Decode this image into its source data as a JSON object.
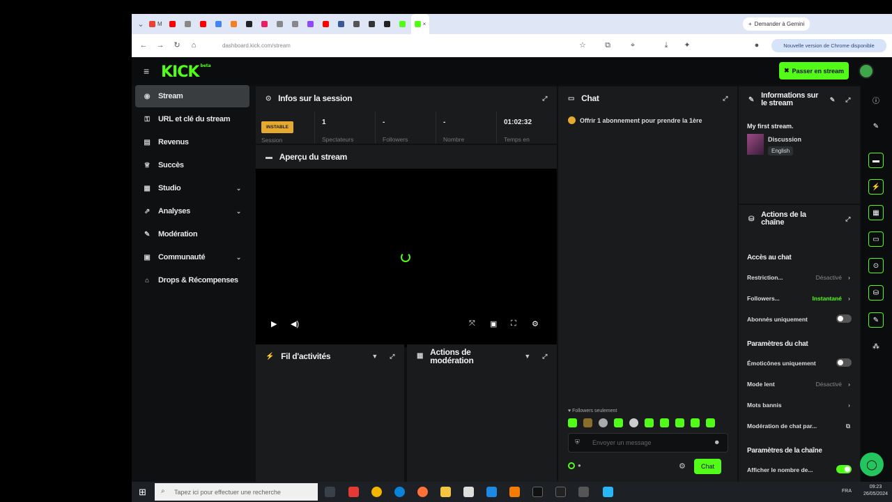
{
  "browser": {
    "tabs": [
      {
        "label": "M",
        "color": "#ea4335"
      },
      {
        "label": "",
        "color": "#ff0000"
      },
      {
        "label": "",
        "color": "#888"
      },
      {
        "label": "",
        "color": "#ff0000"
      },
      {
        "label": "",
        "color": "#4285f4"
      },
      {
        "label": "",
        "color": "#f48024"
      },
      {
        "label": "",
        "color": "#222"
      },
      {
        "label": "",
        "color": "#e91e63"
      },
      {
        "label": "",
        "color": "#888"
      },
      {
        "label": "",
        "color": "#888"
      },
      {
        "label": "",
        "color": "#9146ff"
      },
      {
        "label": "",
        "color": "#ff0000"
      },
      {
        "label": "",
        "color": "#3b5998"
      },
      {
        "label": "",
        "color": "#555"
      },
      {
        "label": "",
        "color": "#333"
      },
      {
        "label": "",
        "color": "#222"
      },
      {
        "label": "",
        "color": "#53fc18"
      }
    ],
    "ask_gemini": "Demander à Gemini",
    "url": "dashboard.kick.com/stream",
    "new_version": "Nouvelle version de Chrome disponible"
  },
  "topbar": {
    "logo": "KICK",
    "logo_sup": "beta",
    "go_live": "Passer en stream"
  },
  "sidebar": {
    "items": [
      {
        "label": "Stream",
        "icon": "stream-icon"
      },
      {
        "label": "URL et clé du stream",
        "icon": "key-icon"
      },
      {
        "label": "Revenus",
        "icon": "revenue-icon"
      },
      {
        "label": "Succès",
        "icon": "trophy-icon"
      },
      {
        "label": "Studio",
        "icon": "studio-icon"
      },
      {
        "label": "Analyses",
        "icon": "analytics-icon"
      },
      {
        "label": "Modération",
        "icon": "wrench-icon"
      },
      {
        "label": "Communauté",
        "icon": "community-icon"
      },
      {
        "label": "Drops & Récompenses",
        "icon": "gift-icon"
      }
    ]
  },
  "session": {
    "title": "Infos sur la session",
    "badge": "INSTABLE",
    "badge_label": "Session",
    "stats": [
      {
        "value": "1",
        "label": "Spectateurs"
      },
      {
        "value": "-",
        "label": "Followers"
      },
      {
        "value": "-",
        "label": "Nombre"
      },
      {
        "value": "01:02:32",
        "label": "Temps en"
      }
    ]
  },
  "preview": {
    "title": "Aperçu du stream"
  },
  "activity": {
    "title": "Fil d'activités"
  },
  "modactions": {
    "title": "Actions de modération"
  },
  "chat": {
    "title": "Chat",
    "gift_msg": "Offrir 1 abonnement pour prendre la 1ère",
    "followers_only": "Followers seulement",
    "placeholder": "Envoyer un message",
    "send": "Chat"
  },
  "info": {
    "title": "Informations sur le stream",
    "stream_title": "My first stream.",
    "category": "Discussion",
    "language": "English"
  },
  "chanactions": {
    "title": "Actions de la chaîne",
    "section_chat_access": "Accès au chat",
    "restriction": "Restriction...",
    "restriction_val": "Désactivé",
    "followers": "Followers...",
    "followers_val": "Instantané",
    "subs_only": "Abonnés uniquement",
    "section_chat_params": "Paramètres du chat",
    "emotes_only": "Émoticônes uniquement",
    "slow_mode": "Mode lent",
    "slow_mode_val": "Désactivé",
    "banned_words": "Mots bannis",
    "chat_moderation": "Modération de chat par...",
    "section_channel_params": "Paramètres de la chaîne",
    "show_count": "Afficher le nombre de..."
  },
  "taskbar": {
    "search_placeholder": "Tapez ici pour effectuer une recherche",
    "lang": "FRA",
    "time": "09:23",
    "date": "26/05/2024"
  },
  "colors": {
    "accent": "#53fc18",
    "warning": "#e6a92f"
  }
}
